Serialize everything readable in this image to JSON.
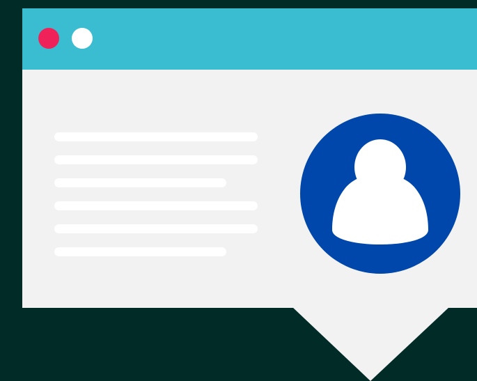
{
  "window": {
    "titlebar_color": "#3bbdd1",
    "content_color": "#f2f2f2",
    "controls": [
      {
        "name": "close-dot",
        "color": "#ef235a"
      },
      {
        "name": "neutral-dot",
        "color": "#ffffff"
      }
    ]
  },
  "content": {
    "text_placeholder_lines": 6,
    "text_line_color": "#ffffff"
  },
  "avatar": {
    "icon": "user-icon",
    "background_color": "#0047ab",
    "figure_color": "#ffffff"
  },
  "background_color": "#002b27",
  "speech_tail": {
    "present": true,
    "color": "#f2f2f2"
  }
}
